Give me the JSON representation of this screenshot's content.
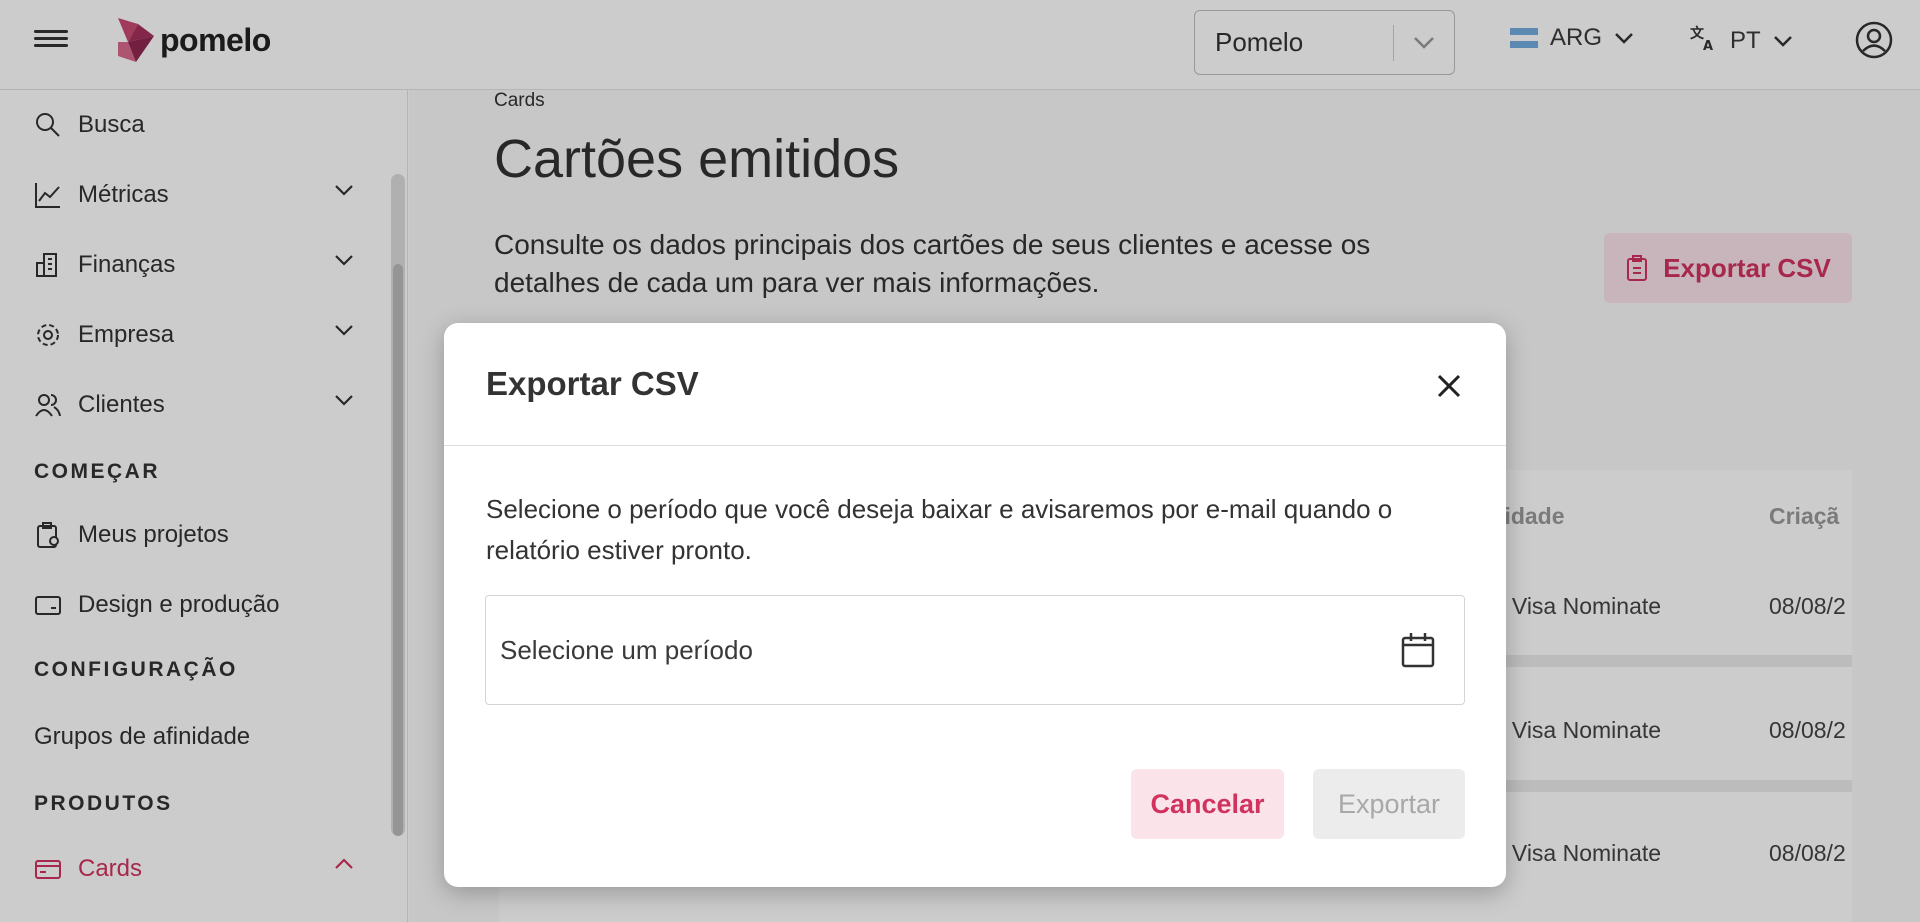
{
  "header": {
    "logo_text": "pomelo",
    "org_select": {
      "value": "Pomelo"
    },
    "country": {
      "code": "ARG"
    },
    "language": {
      "code": "PT"
    }
  },
  "sidebar": {
    "items": [
      {
        "label": "Busca",
        "icon": "search-icon"
      },
      {
        "label": "Métricas",
        "icon": "chart-icon"
      },
      {
        "label": "Finanças",
        "icon": "building-icon"
      },
      {
        "label": "Empresa",
        "icon": "gear-icon"
      },
      {
        "label": "Clientes",
        "icon": "users-icon"
      }
    ],
    "section_start": "COMEÇAR",
    "start_items": [
      {
        "label": "Meus projetos",
        "icon": "clipboard-gear-icon"
      },
      {
        "label": "Design e produção",
        "icon": "card-icon"
      }
    ],
    "section_config": "CONFIGURAÇÃO",
    "config_items": [
      {
        "label": "Grupos de afinidade"
      }
    ],
    "section_products": "PRODUTOS",
    "product_items": [
      {
        "label": "Cards",
        "icon": "card-icon",
        "active": true
      }
    ]
  },
  "page": {
    "breadcrumb": "Cards",
    "title": "Cartões emitidos",
    "description": "Consulte os dados principais dos cartões de seus clientes e acesse os detalhes de cada um para ver mais informações.",
    "export_button": "Exportar CSV"
  },
  "table": {
    "headers": [
      "inidade",
      "Criaçã"
    ],
    "rows": [
      [
        "it Visa Nominate",
        "08/08/2"
      ],
      [
        "it Visa Nominate",
        "08/08/2"
      ],
      [
        "it Visa Nominate",
        "08/08/2"
      ]
    ]
  },
  "modal": {
    "title": "Exportar CSV",
    "text": "Selecione o período que você deseja baixar e avisaremos por e-mail quando o relatório estiver pronto.",
    "date_placeholder": "Selecione um período",
    "cancel": "Cancelar",
    "export": "Exportar"
  },
  "colors": {
    "accent": "#d1335f",
    "accent_light": "#fbe3ea",
    "disabled_bg": "#ececec",
    "disabled_text": "#a8a8a8"
  }
}
